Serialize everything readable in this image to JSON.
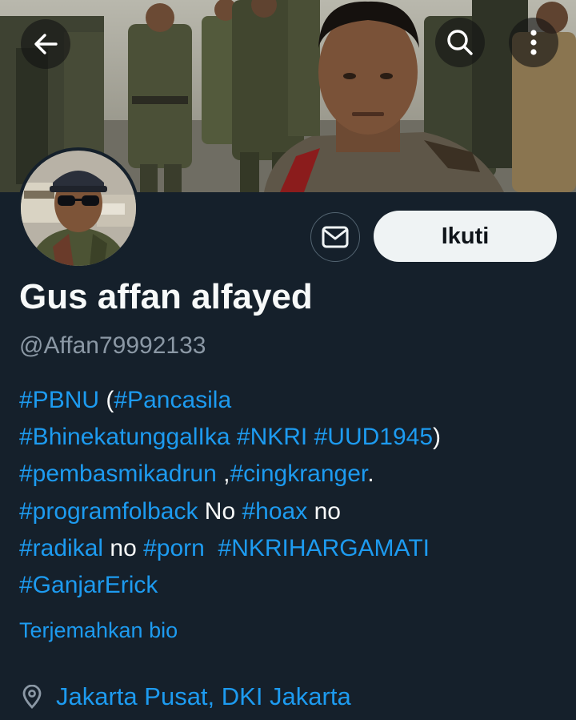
{
  "header": {
    "back_icon": "arrow-left-icon",
    "search_icon": "search-icon",
    "more_icon": "more-vertical-icon"
  },
  "profile": {
    "display_name": "Gus affan alfayed",
    "handle": "@Affan79992133",
    "follow_label": "Ikuti",
    "message_icon": "envelope-icon",
    "translate_label": "Terjemahkan bio",
    "location": "Jakarta Pusat, DKI Jakarta",
    "location_icon": "location-pin-icon"
  },
  "bio": {
    "lines": [
      [
        {
          "t": "#PBNU",
          "tag": true
        },
        {
          "t": " (",
          "tag": false
        },
        {
          "t": "#Pancasila",
          "tag": true
        }
      ],
      [
        {
          "t": "#BhinekatunggalIka",
          "tag": true
        },
        {
          "t": " ",
          "tag": false
        },
        {
          "t": "#NKRI",
          "tag": true
        },
        {
          "t": " ",
          "tag": false
        },
        {
          "t": "#UUD1945",
          "tag": true
        },
        {
          "t": ")",
          "tag": false
        }
      ],
      [
        {
          "t": "#pembasmikadrun",
          "tag": true
        },
        {
          "t": " ,",
          "tag": false
        },
        {
          "t": "#cingkranger",
          "tag": true
        },
        {
          "t": ".",
          "tag": false
        }
      ],
      [
        {
          "t": "#programfolback",
          "tag": true
        },
        {
          "t": " No ",
          "tag": false
        },
        {
          "t": "#hoax",
          "tag": true
        },
        {
          "t": " no",
          "tag": false
        }
      ],
      [
        {
          "t": "#radikal",
          "tag": true
        },
        {
          "t": " no ",
          "tag": false
        },
        {
          "t": "#porn",
          "tag": true
        },
        {
          "t": "  ",
          "tag": false
        },
        {
          "t": "#NKRIHARGAMATI",
          "tag": true
        }
      ],
      [
        {
          "t": "#GanjarErick",
          "tag": true
        }
      ]
    ]
  },
  "colors": {
    "background": "#15202b",
    "link": "#1d9bf0",
    "text": "#f7f9f9",
    "muted": "#8b98a5",
    "button_bg": "#eff3f4"
  }
}
